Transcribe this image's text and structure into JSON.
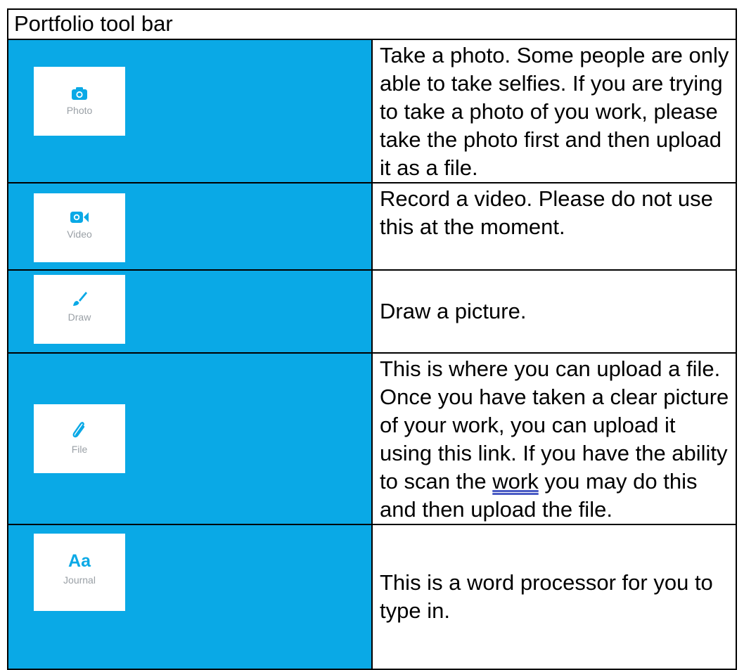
{
  "title": "Portfolio tool bar",
  "colors": {
    "accent": "#0aa9e6",
    "icon_label": "#9aa0a6"
  },
  "rows": [
    {
      "icon": "camera-icon",
      "label": "Photo",
      "text": "Take a photo. Some people are only able to take selfies. If you are trying to take a photo of you work, please take the photo first and then upload it as a file."
    },
    {
      "icon": "video-camera-icon",
      "label": "Video",
      "text": "Record a video. Please do not use this at the moment."
    },
    {
      "icon": "paintbrush-icon",
      "label": "Draw",
      "text": "Draw a picture."
    },
    {
      "icon": "paperclip-icon",
      "label": "File",
      "text_before": "This is where you can upload a file. Once you have taken a clear picture of your work, you can upload it using this link. If you have the ability to scan the ",
      "text_underlined": "work",
      "text_after": " you may do this and then upload the file."
    },
    {
      "icon": "text-aa-icon",
      "label": "Journal",
      "glyph": "Aa",
      "text": "This is a word processor for you to type in."
    }
  ]
}
